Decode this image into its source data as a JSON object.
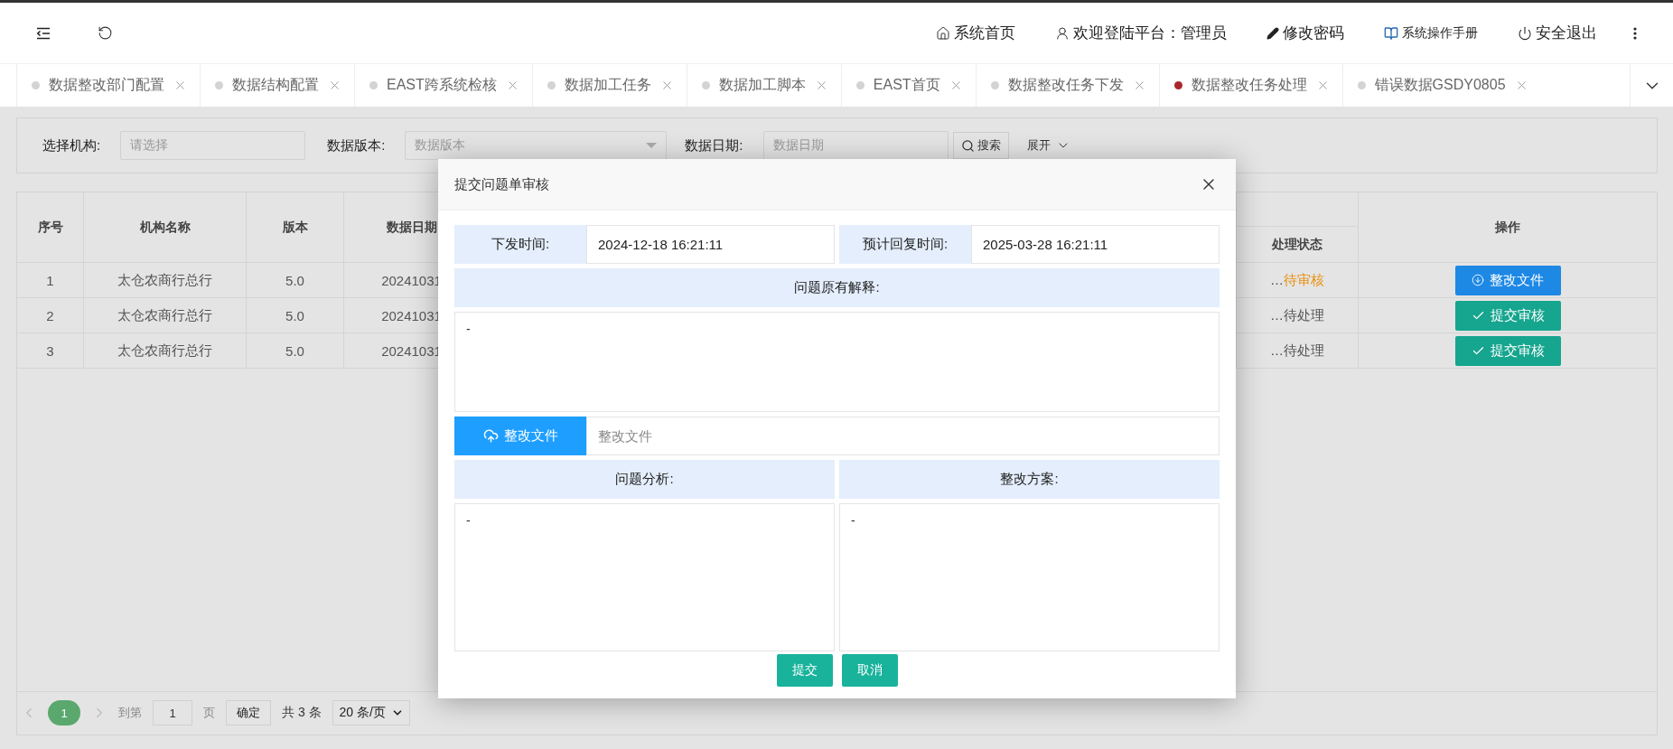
{
  "header": {
    "items": [
      {
        "kind": "home",
        "label": "系统首页"
      },
      {
        "kind": "user",
        "label": "欢迎登陆平台：管理员"
      },
      {
        "kind": "password",
        "label": "修改密码"
      },
      {
        "kind": "manual",
        "label": "系统操作手册"
      },
      {
        "kind": "logout",
        "label": "安全退出"
      }
    ]
  },
  "tabs": [
    {
      "label": "数据整改部门配置",
      "selected": false
    },
    {
      "label": "数据结构配置",
      "selected": false
    },
    {
      "label": "EAST跨系统检核",
      "selected": false
    },
    {
      "label": "数据加工任务",
      "selected": false
    },
    {
      "label": "数据加工脚本",
      "selected": false
    },
    {
      "label": "EAST首页",
      "selected": false
    },
    {
      "label": "数据整改任务下发",
      "selected": false
    },
    {
      "label": "数据整改任务处理",
      "selected": true
    },
    {
      "label": "错误数据GSDY0805",
      "selected": false
    }
  ],
  "filters": [
    {
      "kind": "input",
      "label": "选择机构:",
      "placeholder": "请选择"
    },
    {
      "kind": "select",
      "label": "数据版本:",
      "placeholder": "数据版本"
    },
    {
      "kind": "input",
      "label": "数据日期:",
      "placeholder": "数据日期"
    }
  ],
  "search_button": "搜索",
  "expand_button": "展开",
  "table": {
    "columns": [
      "序号",
      "机构名称",
      "版本",
      "数据日期",
      "处理状态",
      "操作"
    ],
    "rows": [
      {
        "cells": [
          "1",
          "太仓农商行总行",
          "5.0",
          "20241031"
        ],
        "status": {
          "prefix": "…",
          "label": "待审核",
          "kind": "review"
        },
        "action": {
          "kind": "download",
          "label": "整改文件"
        }
      },
      {
        "cells": [
          "2",
          "太仓农商行总行",
          "5.0",
          "20241031"
        ],
        "status": {
          "prefix": "…",
          "label": "待处理",
          "kind": "pending"
        },
        "action": {
          "kind": "submit",
          "label": "提交审核"
        }
      },
      {
        "cells": [
          "3",
          "太仓农商行总行",
          "5.0",
          "20241031"
        ],
        "status": {
          "prefix": "…",
          "label": "待处理",
          "kind": "pending"
        },
        "action": {
          "kind": "submit",
          "label": "提交审核"
        }
      }
    ]
  },
  "pagination": {
    "pages": [
      {
        "label": "1",
        "selected": true
      }
    ],
    "goto_label": "到第",
    "goto_value": "1",
    "page_unit": "页",
    "confirm": "确定",
    "total": "共 3 条",
    "page_size": "20 条/页"
  },
  "dialog": {
    "title": "提交问题单审核",
    "issue_time_label": "下发时间:",
    "issue_time": "2024-12-18 16:21:11",
    "reply_time_label": "预计回复时间:",
    "reply_time": "2025-03-28 16:21:11",
    "explanation_label": "问题原有解释:",
    "explanation": "-",
    "upload_button": "整改文件",
    "upload_placeholder": "整改文件",
    "analysis_label": "问题分析:",
    "analysis": "-",
    "plan_label": "整改方案:",
    "plan": "-",
    "buttons": [
      "提交",
      "取消"
    ]
  }
}
